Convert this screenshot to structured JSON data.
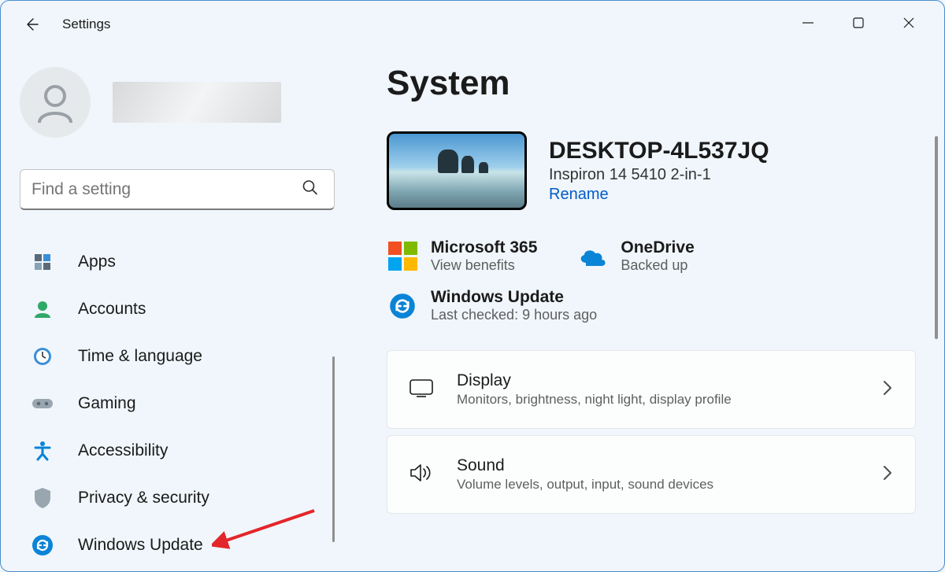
{
  "window": {
    "app_title": "Settings"
  },
  "sidebar": {
    "search_placeholder": "Find a setting",
    "nav": [
      {
        "label": "Apps"
      },
      {
        "label": "Accounts"
      },
      {
        "label": "Time & language"
      },
      {
        "label": "Gaming"
      },
      {
        "label": "Accessibility"
      },
      {
        "label": "Privacy & security"
      },
      {
        "label": "Windows Update"
      }
    ]
  },
  "main": {
    "page_title": "System",
    "device": {
      "name": "DESKTOP-4L537JQ",
      "model": "Inspiron 14 5410 2-in-1",
      "rename": "Rename"
    },
    "status": {
      "ms365": {
        "title": "Microsoft 365",
        "sub": "View benefits"
      },
      "onedrive": {
        "title": "OneDrive",
        "sub": "Backed up"
      },
      "wu": {
        "title": "Windows Update",
        "sub": "Last checked: 9 hours ago"
      }
    },
    "cards": [
      {
        "title": "Display",
        "sub": "Monitors, brightness, night light, display profile"
      },
      {
        "title": "Sound",
        "sub": "Volume levels, output, input, sound devices"
      }
    ]
  }
}
